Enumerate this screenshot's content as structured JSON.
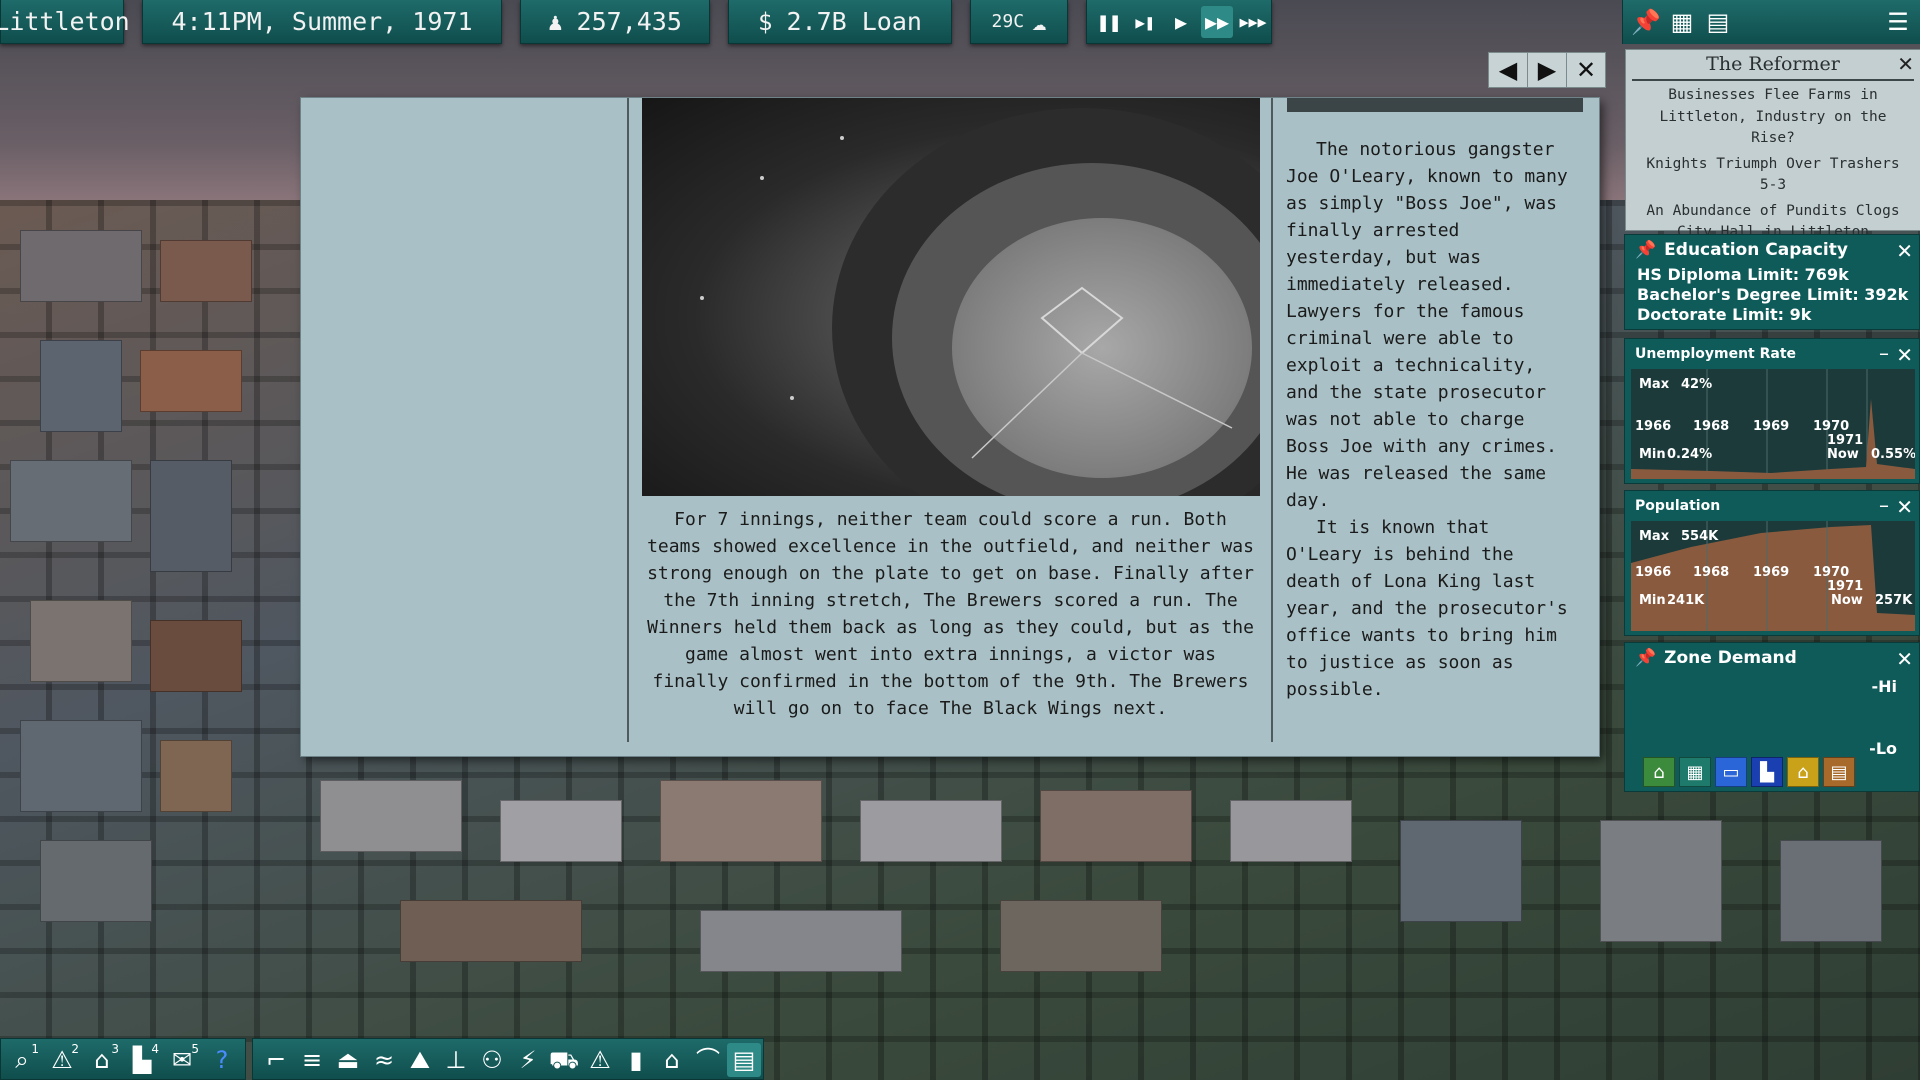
{
  "topbar": {
    "city_name": "Littleton",
    "datetime": "4:11PM, Summer, 1971",
    "population": "257,435",
    "money": "2.7B Loan",
    "money_symbol": "$",
    "temperature": "29C"
  },
  "speed_controls": [
    "pause",
    "step",
    "play",
    "fast",
    "fastest"
  ],
  "newspaper": {
    "nav_prev_icon": "◀",
    "nav_next_icon": "▶",
    "close_icon": "✕",
    "left_article": "For 7 innings, neither team could score a run. Both teams showed excellence in the outfield, and neither was strong enough on the plate to get on base. Finally after the 7th inning stretch, The Brewers scored a run. The Winners held them back as long as they could, but as the game almost went into extra innings, a victor was finally confirmed in the bottom of the 9th. The Brewers will go on to face The Black Wings next.",
    "right_article_p1": "The notorious gangster Joe O'Leary, known to many as simply \"Boss Joe\", was finally arrested yesterday, but was immediately released. Lawyers for the famous criminal were able to exploit a technicality, and the state prosecutor was not able to charge Boss Joe with any crimes. He was released the same day.",
    "right_article_p2": "It is known that O'Leary is behind the death of Lona King last year, and the prosecutor's office wants to bring him to justice as soon as possible."
  },
  "reformer": {
    "title": "The Reformer",
    "headlines": [
      "Businesses Flee Farms in Littleton, Industry on the Rise?",
      "Knights Triumph Over Trashers 5-3",
      "An Abundance of Pundits Clogs City Hall in Littleton"
    ]
  },
  "education": {
    "title": "Education Capacity",
    "hs": "HS Diploma Limit: 769k",
    "bachelor": "Bachelor's Degree Limit: 392k",
    "doctorate": "Doctorate Limit: 9k"
  },
  "unemployment": {
    "title": "Unemployment Rate",
    "max_label": "Max",
    "max_value": "42%",
    "min_label": "Min",
    "min_value": "0.24%",
    "now_label": "Now",
    "now_value": "0.55%",
    "years": [
      "1966",
      "1968",
      "1969",
      "1970",
      "1971"
    ]
  },
  "population_graph": {
    "title": "Population",
    "max_label": "Max",
    "max_value": "554K",
    "min_label": "Min",
    "min_value": "241K",
    "now_label": "Now",
    "now_value": "257K",
    "years": [
      "1966",
      "1968",
      "1969",
      "1970",
      "1971"
    ]
  },
  "zone_demand": {
    "title": "Zone Demand",
    "hi": "-Hi",
    "lo": "-Lo",
    "zones": [
      {
        "name": "residential",
        "color": "#3c8a3c",
        "icon": "⌂"
      },
      {
        "name": "office",
        "color": "#1e7a6a",
        "icon": "▦"
      },
      {
        "name": "commercial",
        "color": "#2a66d8",
        "icon": "▭"
      },
      {
        "name": "industrial",
        "color": "#1a3fb0",
        "icon": "▙"
      },
      {
        "name": "agriculture",
        "color": "#c9a21a",
        "icon": "⌂"
      },
      {
        "name": "farm",
        "color": "#a86a2a",
        "icon": "▤"
      }
    ]
  },
  "bottom_left_tools": [
    {
      "name": "search",
      "icon": "⌕",
      "badge": "1"
    },
    {
      "name": "warning",
      "icon": "⚠",
      "badge": "2"
    },
    {
      "name": "houses",
      "icon": "⌂",
      "badge": "3"
    },
    {
      "name": "factory",
      "icon": "▙",
      "badge": "4"
    },
    {
      "name": "money",
      "icon": "✉",
      "badge": "5"
    },
    {
      "name": "help",
      "icon": "?",
      "badge": ""
    }
  ],
  "bottom_build_tools": [
    "road",
    "rail",
    "utility",
    "water",
    "landscape",
    "monument",
    "people",
    "power",
    "transport",
    "hazard",
    "tower",
    "house",
    "park",
    "news"
  ]
}
